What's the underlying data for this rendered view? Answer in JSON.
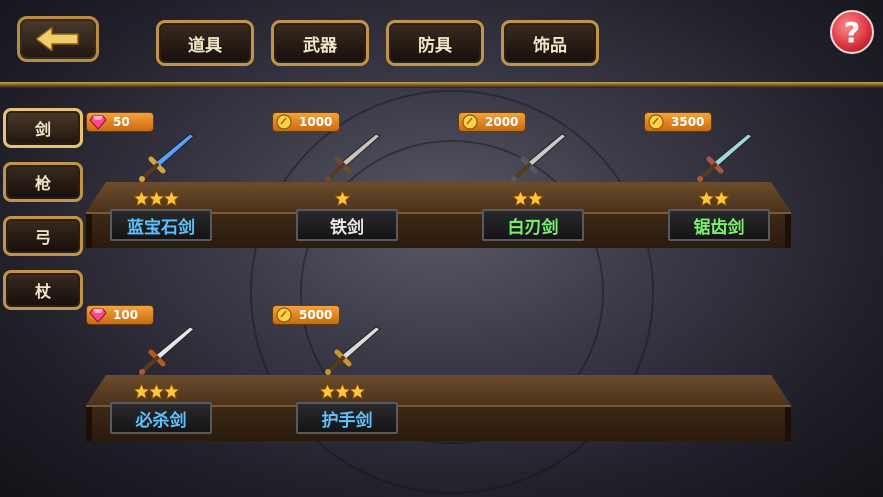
{
  "colors": {
    "name_blue": "#5ec2ff",
    "name_white": "#e8e8e8",
    "name_green": "#7af070",
    "star": "#ffc83a"
  },
  "top_tabs": [
    "道具",
    "武器",
    "防具",
    "饰品"
  ],
  "side_categories": [
    "剑",
    "枪",
    "弓",
    "杖"
  ],
  "help_label": "?",
  "items": [
    {
      "price": "50",
      "currency": "gem-icon",
      "stars": 3,
      "name": "蓝宝石剑",
      "name_color": "#5ec2ff"
    },
    {
      "price": "1000",
      "currency": "gold-coin-icon",
      "stars": 1,
      "name": "铁剑",
      "name_color": "#e8e8e8"
    },
    {
      "price": "2000",
      "currency": "gold-coin-icon",
      "stars": 2,
      "name": "白刃剑",
      "name_color": "#7af070"
    },
    {
      "price": "3500",
      "currency": "gold-coin-icon",
      "stars": 2,
      "name": "锯齿剑",
      "name_color": "#7af070"
    },
    {
      "price": "100",
      "currency": "gem-icon",
      "stars": 3,
      "name": "必杀剑",
      "name_color": "#5ec2ff"
    },
    {
      "price": "5000",
      "currency": "gold-coin-icon",
      "stars": 3,
      "name": "护手剑",
      "name_color": "#5ec2ff"
    }
  ]
}
